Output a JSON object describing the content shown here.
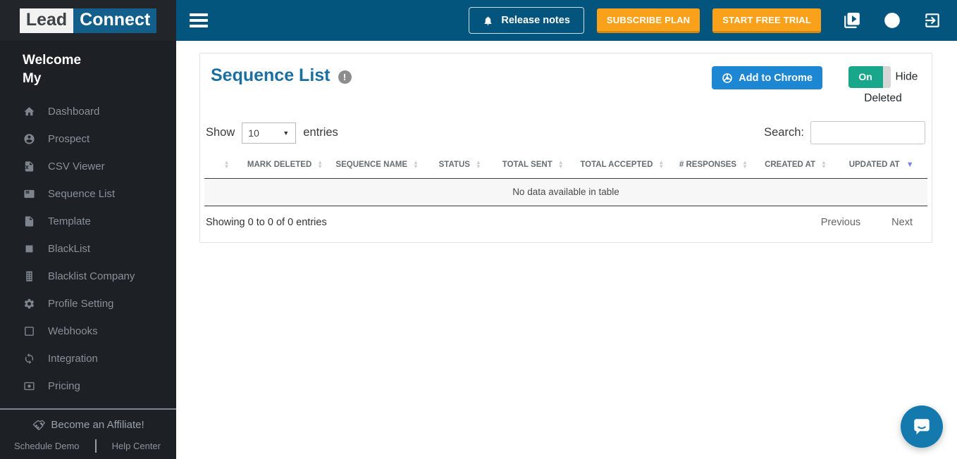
{
  "app": {
    "logo_lead": "Lead",
    "logo_connect": "Connect"
  },
  "sidebar": {
    "welcome": "Welcome My",
    "items": [
      {
        "label": "Dashboard",
        "icon": "home-icon"
      },
      {
        "label": "Prospect",
        "icon": "person-icon"
      },
      {
        "label": "CSV Viewer",
        "icon": "csv-file-icon"
      },
      {
        "label": "Sequence List",
        "icon": "list-card-icon"
      },
      {
        "label": "Template",
        "icon": "file-icon"
      },
      {
        "label": "BlackList",
        "icon": "filled-square-icon"
      },
      {
        "label": "Blacklist Company",
        "icon": "building-icon"
      },
      {
        "label": "Profile Setting",
        "icon": "gear-icon"
      },
      {
        "label": "Webhooks",
        "icon": "square-outline-icon"
      },
      {
        "label": "Integration",
        "icon": "sync-icon"
      },
      {
        "label": "Pricing",
        "icon": "money-icon"
      }
    ],
    "affiliate_label": "Become an Affiliate!",
    "schedule_demo": "Schedule Demo",
    "help_center": "Help Center"
  },
  "header": {
    "release_notes": "Release notes",
    "subscribe_plan": "SUBSCRIBE PLAN",
    "start_free_trial": "START FREE TRIAL",
    "icons": [
      "video-library-icon",
      "chrome-icon",
      "logout-icon"
    ]
  },
  "main": {
    "title": "Sequence List",
    "add_to_chrome": "Add to Chrome",
    "toggle_state": "On",
    "toggle_label": "Hide Deleted",
    "show_label": "Show",
    "page_length": "10",
    "entries_label": "entries",
    "search_label": "Search:",
    "table": {
      "columns": [
        "",
        "MARK DELETED",
        "SEQUENCE NAME",
        "STATUS",
        "TOTAL SENT",
        "TOTAL ACCEPTED",
        "# RESPONSES",
        "CREATED AT",
        "UPDATED AT"
      ],
      "active_sort": {
        "column": "UPDATED AT",
        "direction": "desc"
      },
      "empty_message": "No data available in table"
    },
    "summary": "Showing 0 to 0 of 0 entries",
    "pagination": {
      "previous": "Previous",
      "next": "Next"
    }
  },
  "colors": {
    "header_bg": "#04557d",
    "sidebar_bg": "#1d2125",
    "accent_orange": "#f9a11b",
    "button_blue": "#1d87d3",
    "toggle_teal": "#19a78c",
    "title_blue": "#1b6fa1",
    "chat_fab_blue": "#1479ad"
  }
}
